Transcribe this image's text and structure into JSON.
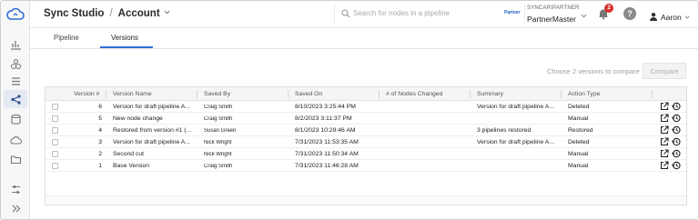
{
  "header": {
    "app_title": "Sync Studio",
    "separator": "/",
    "account_label": "Account"
  },
  "search": {
    "placeholder": "Search for nodes in a pipeline",
    "value": ""
  },
  "partner": {
    "logo_text": "Partner",
    "label": "SYNCARIPARTNER",
    "name": "PartnerMaster"
  },
  "notifications": {
    "count": "2"
  },
  "help": {
    "label": "?"
  },
  "user": {
    "name": "Aaron"
  },
  "tabs": [
    {
      "label": "Pipeline",
      "active": false
    },
    {
      "label": "Versions",
      "active": true
    }
  ],
  "compare": {
    "hint": "Choose 2 versions to compare",
    "button_label": "Compare"
  },
  "table": {
    "columns": [
      "Version #",
      "Version Name",
      "Saved By",
      "Saved On",
      "# of Nodes Changed",
      "Summary",
      "Action Type"
    ],
    "rows": [
      {
        "version": "6",
        "name": "Version for draft pipeline A...",
        "saved_by": "Craig Smith",
        "saved_on": "8/10/2023 3:25:44 PM",
        "nodes_changed": "",
        "summary": "Version for draft pipeline A...",
        "action": "Deleted"
      },
      {
        "version": "5",
        "name": "New node change",
        "saved_by": "Craig Smith",
        "saved_on": "8/2/2023 3:11:37 PM",
        "nodes_changed": "",
        "summary": "",
        "action": "Manual"
      },
      {
        "version": "4",
        "name": "Restored from version #1 (...",
        "saved_by": "Susan Green",
        "saved_on": "8/1/2023 10:29:46 AM",
        "nodes_changed": "",
        "summary": "3 pipelines restored",
        "action": "Restored"
      },
      {
        "version": "3",
        "name": "Version for draft pipeline A...",
        "saved_by": "Nick Wright",
        "saved_on": "7/31/2023 11:53:35 AM",
        "nodes_changed": "",
        "summary": "Version for draft pipeline A...",
        "action": "Deleted"
      },
      {
        "version": "2",
        "name": "Second cut",
        "saved_by": "Nick Wright",
        "saved_on": "7/31/2023 11:50:34 AM",
        "nodes_changed": "",
        "summary": "",
        "action": "Manual"
      },
      {
        "version": "1",
        "name": "Base Version",
        "saved_by": "Craig Smith",
        "saved_on": "7/31/2023 11:46:28 AM",
        "nodes_changed": "",
        "summary": "",
        "action": "Manual"
      }
    ]
  },
  "colors": {
    "accent": "#2f6fd6",
    "badge": "#d9302b"
  },
  "icons": {
    "rail": [
      "cloud-logo-icon",
      "dashboard-icon",
      "bug-icon",
      "list-icon",
      "pipeline-icon",
      "database-icon",
      "cloud-upload-icon",
      "folder-icon",
      "sliders-icon",
      "expand-chevron-icon"
    ],
    "row_actions": [
      "open-external-icon",
      "history-icon"
    ]
  }
}
